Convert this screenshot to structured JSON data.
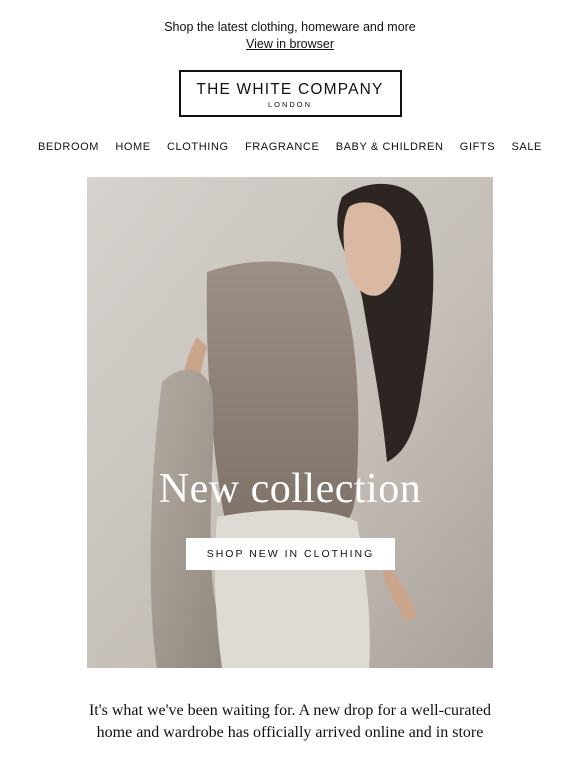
{
  "preheader": {
    "text": "Shop the latest clothing, homeware and more",
    "view_link": "View in browser"
  },
  "logo": {
    "name": "THE WHITE COMPANY",
    "subtitle": "LONDON"
  },
  "nav": {
    "items": [
      "BEDROOM",
      "HOME",
      "CLOTHING",
      "FRAGRANCE",
      "BABY & CHILDREN",
      "GIFTS",
      "SALE"
    ]
  },
  "hero": {
    "title": "New collection",
    "cta_label": "SHOP NEW IN CLOTHING"
  },
  "intro": {
    "text": "It's what we've been waiting for. A new drop for a well-curated home and wardrobe has officially arrived online and in store"
  }
}
